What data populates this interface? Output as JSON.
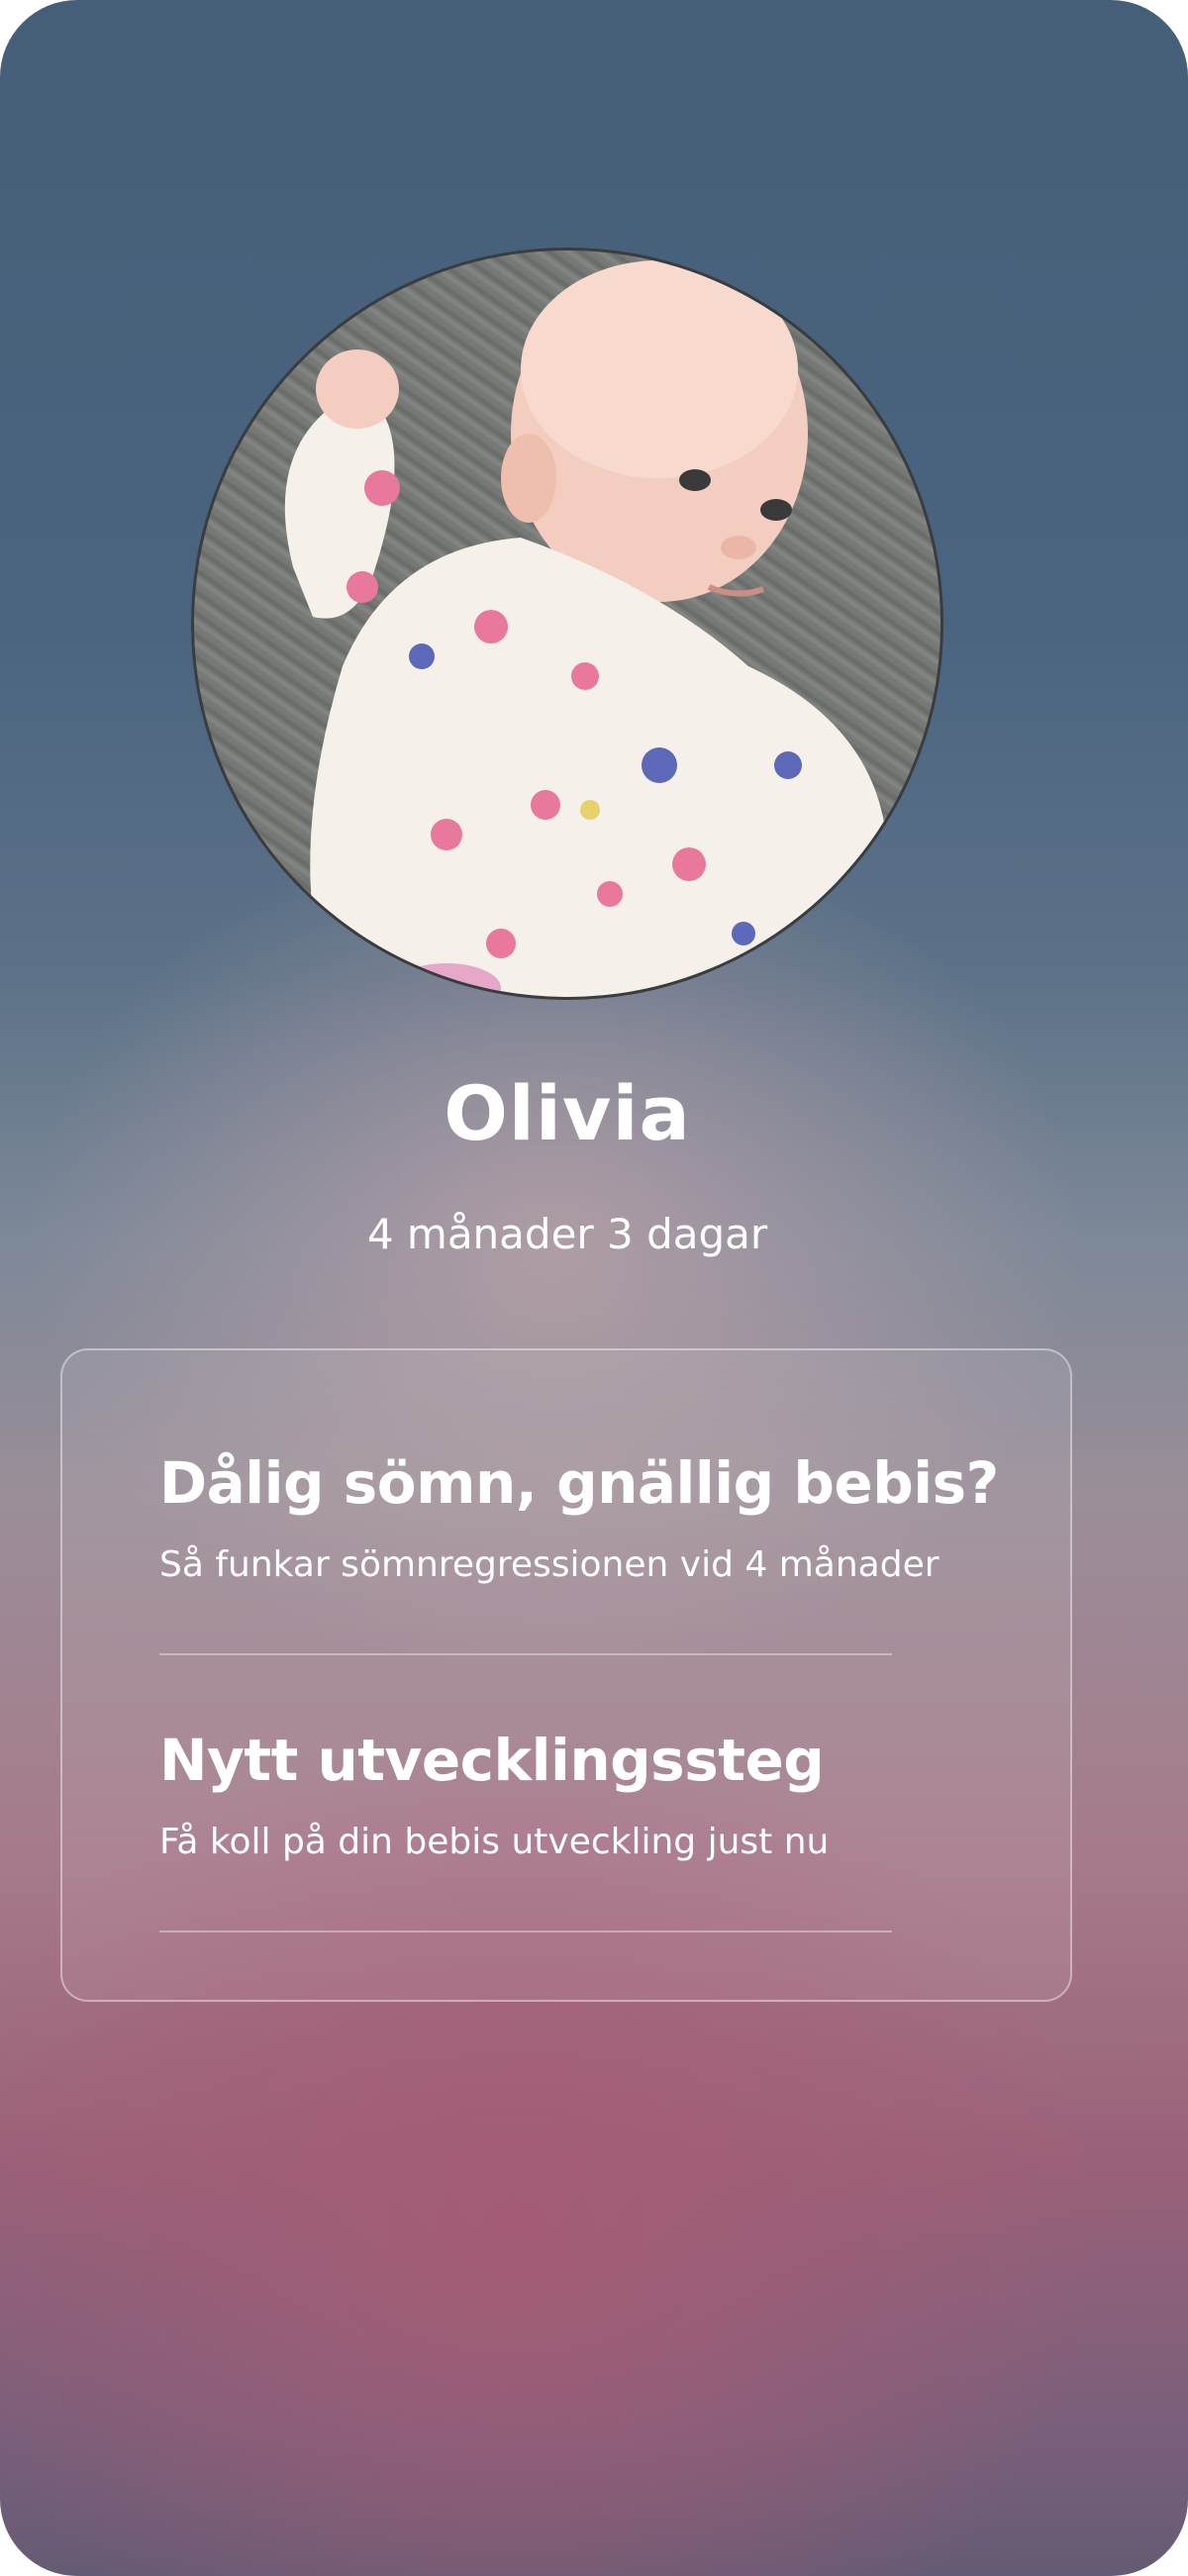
{
  "profile": {
    "name": "Olivia",
    "age": "4 månader 3 dagar",
    "photo_icon": "baby-photo"
  },
  "articles": [
    {
      "title": "Dålig sömn, gnällig bebis?",
      "subtitle": "Så funkar sömnregressionen vid 4 månader"
    },
    {
      "title": "Nytt utvecklingssteg",
      "subtitle": "Få koll på din bebis utveckling just nu"
    }
  ],
  "colors": {
    "background_top": "#465f78",
    "background_bottom": "#9a6179",
    "text": "#ffffff"
  }
}
